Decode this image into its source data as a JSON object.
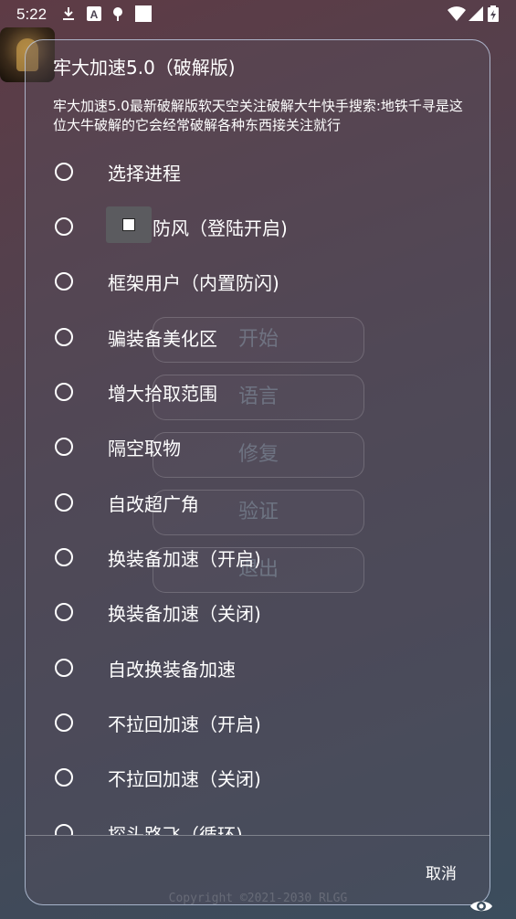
{
  "status_bar": {
    "time": "5:22",
    "icons": [
      "download-icon",
      "a-icon",
      "vpn-key-icon",
      "square-icon",
      "wifi-icon",
      "signal-icon",
      "battery-icon"
    ]
  },
  "background_buttons": [
    {
      "label": "开始"
    },
    {
      "label": "语言"
    },
    {
      "label": "修复"
    },
    {
      "label": "验证"
    },
    {
      "label": "退出"
    }
  ],
  "copyright": "Copyright ©2021-2030 RLGG",
  "dialog": {
    "title": "牢大加速5.0（破解版)",
    "message": "牢大加速5.0最新破解版软天空关注破解大牛快手搜索:地铁千寻是这位大牛破解的它会经常破解各种东西接关注就行",
    "items": [
      {
        "label": "选择进程"
      },
      {
        "label": "防风（登陆开启)"
      },
      {
        "label": "框架用户（内置防闪)"
      },
      {
        "label": "骗装备美化区"
      },
      {
        "label": "增大拾取范围"
      },
      {
        "label": "隔空取物"
      },
      {
        "label": "自改超广角"
      },
      {
        "label": "换装备加速（开启)"
      },
      {
        "label": "换装备加速（关闭)"
      },
      {
        "label": "自改换装备加速"
      },
      {
        "label": "不拉回加速（开启)"
      },
      {
        "label": "不拉回加速（关闭)"
      },
      {
        "label": "探头路飞（循环)"
      }
    ],
    "cancel_label": "取消"
  }
}
